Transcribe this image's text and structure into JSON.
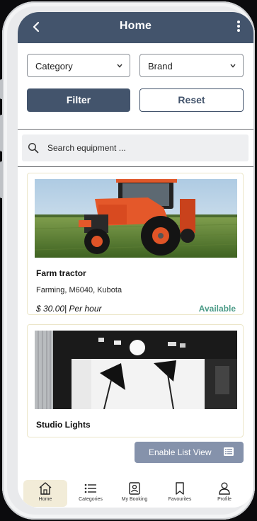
{
  "header": {
    "title": "Home"
  },
  "filters": {
    "category_label": "Category",
    "brand_label": "Brand",
    "filter_button": "Filter",
    "reset_button": "Reset"
  },
  "search": {
    "placeholder": "Search equipment ..."
  },
  "listings": [
    {
      "name": "Farm tractor",
      "details": "Farming, M6040, Kubota",
      "price": "$ 30.00| Per hour",
      "status": "Available"
    },
    {
      "name": "Studio Lights"
    }
  ],
  "list_view_button": "Enable List View",
  "bottom_nav": {
    "items": [
      {
        "label": "Home",
        "icon": "home-icon"
      },
      {
        "label": "Categories",
        "icon": "list-icon"
      },
      {
        "label": "My Booking",
        "icon": "booking-icon"
      },
      {
        "label": "Favourites",
        "icon": "bookmark-icon"
      },
      {
        "label": "Profile",
        "icon": "profile-icon"
      }
    ]
  },
  "colors": {
    "primary": "#43546c",
    "available": "#4a9a86",
    "list_view": "#8592ab",
    "active_tab": "#f2ecd8"
  }
}
